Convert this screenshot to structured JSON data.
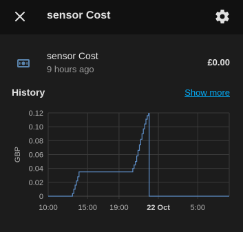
{
  "header": {
    "title": "sensor Cost"
  },
  "entity": {
    "name": "sensor Cost",
    "last_changed": "9 hours ago",
    "value": "£0.00",
    "icon": "cash-icon"
  },
  "history": {
    "title": "History",
    "show_more_label": "Show more"
  },
  "colors": {
    "accent_link": "#03a9f4",
    "series_line": "#5e8fc9",
    "entity_icon": "#5b86b0"
  },
  "chart_data": {
    "type": "line",
    "ylabel": "GBP",
    "ylim": [
      0,
      0.12
    ],
    "y_ticks": [
      "0.12",
      "0.10",
      "0.08",
      "0.06",
      "0.04",
      "0.02",
      "0"
    ],
    "x_ticks": [
      {
        "label": "10:00",
        "bold": false
      },
      {
        "label": "15:00",
        "bold": false
      },
      {
        "label": "19:00",
        "bold": false
      },
      {
        "label": "22 Oct",
        "bold": true
      },
      {
        "label": "5:00",
        "bold": false
      }
    ],
    "grid": true,
    "series": [
      {
        "points": [
          [
            "10:00",
            0
          ],
          [
            "13:00",
            0
          ],
          [
            "13:05",
            0.004
          ],
          [
            "13:15",
            0.01
          ],
          [
            "13:25",
            0.016
          ],
          [
            "13:35",
            0.022
          ],
          [
            "13:45",
            0.028
          ],
          [
            "13:55",
            0.035
          ],
          [
            "18:00",
            0.035
          ],
          [
            "20:40",
            0.035
          ],
          [
            "20:45",
            0.04
          ],
          [
            "20:55",
            0.045
          ],
          [
            "21:05",
            0.05
          ],
          [
            "21:15",
            0.058
          ],
          [
            "21:25",
            0.066
          ],
          [
            "21:35",
            0.074
          ],
          [
            "21:45",
            0.082
          ],
          [
            "21:55",
            0.09
          ],
          [
            "22:05",
            0.097
          ],
          [
            "22:15",
            0.104
          ],
          [
            "22:25",
            0.111
          ],
          [
            "22:35",
            0.116
          ],
          [
            "22:45",
            0.119
          ],
          [
            "22:50",
            0.12
          ],
          [
            "22:50",
            0
          ],
          [
            "09:00",
            0
          ]
        ]
      }
    ]
  }
}
